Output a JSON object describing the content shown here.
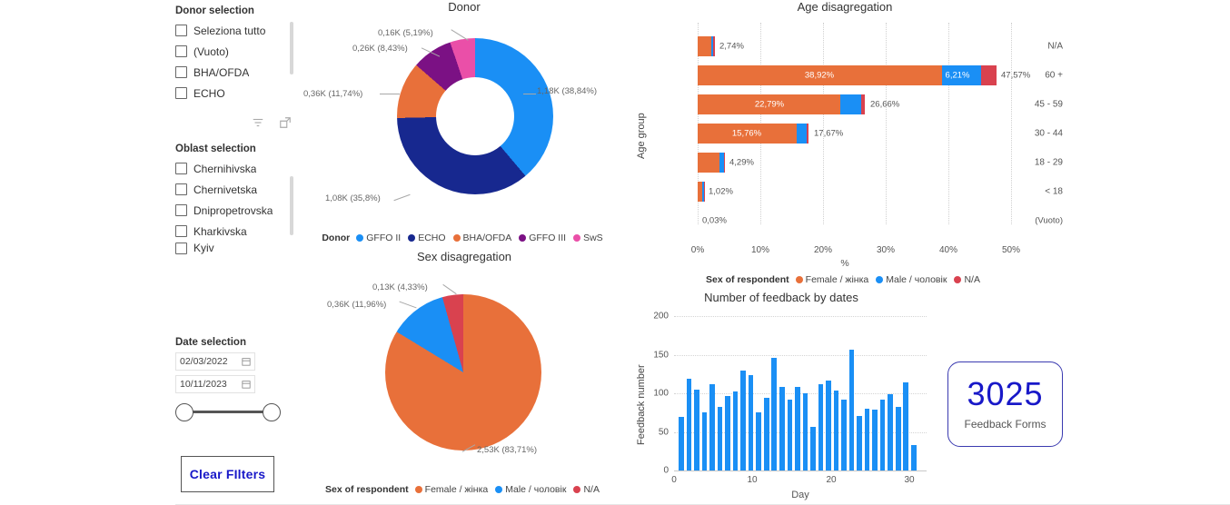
{
  "sidebar": {
    "donor_slicer": {
      "title": "Donor selection",
      "items": [
        {
          "label": "Seleziona tutto",
          "checked": false
        },
        {
          "label": "(Vuoto)",
          "checked": false
        },
        {
          "label": "BHA/OFDA",
          "checked": false
        },
        {
          "label": "ECHO",
          "checked": false
        }
      ]
    },
    "icons": {
      "filter": "filter-icon",
      "focus": "focus-mode-icon"
    },
    "oblast_slicer": {
      "title": "Oblast selection",
      "items": [
        {
          "label": "Chernihivska",
          "checked": false
        },
        {
          "label": "Chernivetska",
          "checked": false
        },
        {
          "label": "Dnipropetrovska",
          "checked": false
        },
        {
          "label": "Kharkivska",
          "checked": false
        },
        {
          "label": "Kyiv",
          "checked": false
        }
      ]
    },
    "date_slicer": {
      "title": "Date selection",
      "start_date": "02/03/2022",
      "end_date": "10/11/2023",
      "calendar_icon": "calendar-icon"
    },
    "clear_filters_label": "Clear FIlters"
  },
  "kpi": {
    "value": "3025",
    "label": "Feedback Forms"
  },
  "colors": {
    "gffo_ii": "#1a8ff5",
    "echo": "#17288f",
    "bha_ofda": "#e8703a",
    "gffo_iii": "#7b1184",
    "sws": "#ea4fa8",
    "female": "#e8703a",
    "male": "#1a8ff5",
    "na": "#d9424f",
    "kpi_accent": "#1818c8"
  },
  "chart_data": [
    {
      "type": "pie",
      "id": "donor-donut",
      "title": "Donor",
      "donut": true,
      "legend_title": "Donor",
      "legend_position": "bottom",
      "labels": [
        "GFFO II",
        "ECHO",
        "BHA/OFDA",
        "GFFO III",
        "SwS"
      ],
      "values": [
        1180,
        1080,
        360,
        260,
        160
      ],
      "value_labels": [
        "1,18K",
        "1,08K",
        "0,36K",
        "0,26K",
        "0,16K"
      ],
      "percents": [
        "38,84%",
        "35,8%",
        "11,74%",
        "8,43%",
        "5,19%"
      ],
      "data_labels": [
        "1,18K (38,84%)",
        "1,08K (35,8%)",
        "0,36K (11,74%)",
        "0,26K (8,43%)",
        "0,16K (5,19%)"
      ],
      "colors": [
        "#1a8ff5",
        "#17288f",
        "#e8703a",
        "#7b1184",
        "#ea4fa8"
      ]
    },
    {
      "type": "pie",
      "id": "sex-pie",
      "title": "Sex disagregation",
      "donut": false,
      "legend_title": "Sex of respondent",
      "legend_position": "bottom",
      "labels": [
        "Female / жінка",
        "Male / чоловік",
        "N/A"
      ],
      "values": [
        2530,
        360,
        130
      ],
      "value_labels": [
        "2,53K",
        "0,36K",
        "0,13K"
      ],
      "percents": [
        "83,71%",
        "11,96%",
        "4,33%"
      ],
      "data_labels": [
        "2,53K (83,71%)",
        "0,36K (11,96%)",
        "0,13K (4,33%)"
      ],
      "colors": [
        "#e8703a",
        "#1a8ff5",
        "#d9424f"
      ]
    },
    {
      "type": "bar",
      "id": "age-disagregation",
      "orientation": "horizontal",
      "stacked": true,
      "title": "Age disagregation",
      "xlabel": "%",
      "ylabel": "Age group",
      "legend_title": "Sex of respondent",
      "legend_position": "bottom",
      "categories": [
        "N/A",
        "60 +",
        "45 - 59",
        "30 - 44",
        "18 - 29",
        "< 18",
        "(Vuoto)"
      ],
      "series": [
        {
          "name": "Female / жінка",
          "color": "#e8703a",
          "values": [
            2.12,
            38.92,
            22.79,
            15.76,
            3.52,
            0.79,
            0.02
          ]
        },
        {
          "name": "Male / чоловік",
          "color": "#1a8ff5",
          "values": [
            0.42,
            6.21,
            3.22,
            1.55,
            0.71,
            0.19,
            0.01
          ]
        },
        {
          "name": "N/A",
          "color": "#d9424f",
          "values": [
            0.2,
            2.44,
            0.65,
            0.36,
            0.06,
            0.04,
            0.0
          ]
        }
      ],
      "totals": [
        "2,74%",
        "47,57%",
        "26,66%",
        "17,67%",
        "4,29%",
        "1,02%",
        "0,03%"
      ],
      "inner_labels": [
        "",
        "38,92%",
        "22,79%",
        "15,76%",
        "",
        "",
        ""
      ],
      "inner_labels_male": [
        "",
        "6,21%",
        "",
        "",
        "",
        "",
        ""
      ],
      "xticks": [
        "0%",
        "10%",
        "20%",
        "30%",
        "40%",
        "50%"
      ],
      "xlim": [
        0,
        55
      ],
      "grid": true
    },
    {
      "type": "bar",
      "id": "feedback-by-dates",
      "orientation": "vertical",
      "title": "Number of feedback by dates",
      "xlabel": "Day",
      "ylabel": "Feedback number",
      "x": [
        1,
        2,
        3,
        4,
        5,
        6,
        7,
        8,
        9,
        10,
        11,
        12,
        13,
        14,
        15,
        16,
        17,
        18,
        19,
        20,
        21,
        22,
        23,
        24,
        25,
        26,
        27,
        28,
        29,
        30,
        31
      ],
      "values": [
        70,
        119,
        105,
        75,
        112,
        82,
        96,
        102,
        130,
        124,
        75,
        94,
        146,
        108,
        92,
        108,
        100,
        56,
        112,
        116,
        104,
        92,
        157,
        71,
        80,
        79,
        92,
        99,
        82,
        114,
        33
      ],
      "yticks": [
        "0",
        "50",
        "100",
        "150",
        "200"
      ],
      "ylim": [
        0,
        200
      ],
      "xticks": [
        "0",
        "10",
        "20",
        "30"
      ],
      "grid": true,
      "color": "#1a8ff5"
    }
  ]
}
